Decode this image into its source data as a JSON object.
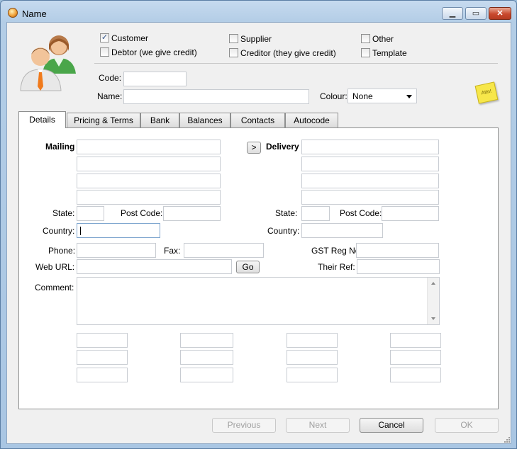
{
  "window": {
    "title": "Name"
  },
  "header": {
    "checkboxes": [
      {
        "label": "Customer",
        "checked": true
      },
      {
        "label": "Debtor (we give credit)",
        "checked": false
      },
      {
        "label": "Supplier",
        "checked": false
      },
      {
        "label": "Creditor (they give credit)",
        "checked": false
      },
      {
        "label": "Other",
        "checked": false
      },
      {
        "label": "Template",
        "checked": false
      }
    ],
    "code_label": "Code:",
    "code_value": "",
    "name_label": "Name:",
    "name_value": "",
    "colour_label": "Colour:",
    "colour_value": "None",
    "note_text": "Attn!"
  },
  "tabs": [
    "Details",
    "Pricing & Terms",
    "Bank",
    "Balances",
    "Contacts",
    "Autocode"
  ],
  "active_tab": "Details",
  "details": {
    "mailing_label": "Mailing",
    "delivery_label": "Delivery",
    "copy_button": ">",
    "state_label": "State:",
    "postcode_label": "Post Code:",
    "country_label": "Country:",
    "phone_label": "Phone:",
    "fax_label": "Fax:",
    "gst_label": "GST Reg No",
    "weburl_label": "Web URL:",
    "go_button": "Go",
    "theirref_label": "Their Ref:",
    "comment_label": "Comment:"
  },
  "footer": {
    "previous": "Previous",
    "next": "Next",
    "cancel": "Cancel",
    "ok": "OK"
  }
}
